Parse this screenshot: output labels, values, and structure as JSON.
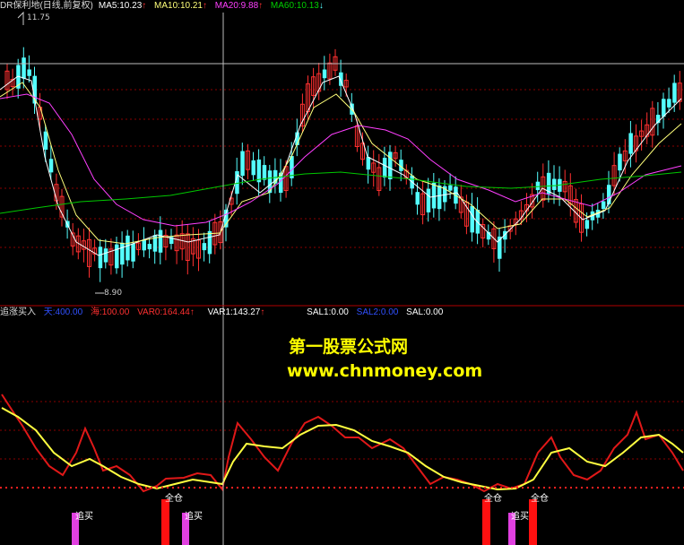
{
  "price_panel": {
    "title": "DR保利地(日线,前复权)",
    "ma5": "MA5:10.23",
    "ma10": "MA10:10.21",
    "ma20": "MA20:9.88",
    "ma60": "MA60:10.13",
    "high_label": "11.75",
    "low_label": "8.90",
    "colors": {
      "up": "#ff3030",
      "down": "#54ffff",
      "ma5": "#ffffff",
      "ma10": "#ffff7a",
      "ma20": "#ff3fff",
      "ma60": "#00c800"
    }
  },
  "indicator_panel": {
    "name": "追涨买入",
    "sky": "天:400.00",
    "sea": "海:100.00",
    "var0": "VAR0:164.44",
    "var1": "VAR1:143.27",
    "sal1": "SAL1:0.00",
    "sal2": "SAL2:0.00",
    "sal": "SAL:0.00",
    "signals": {
      "chase": "追买",
      "full": "全仓"
    }
  },
  "watermark": {
    "title": "第一股票公式网",
    "url": "www.chnmoney.com"
  }
}
